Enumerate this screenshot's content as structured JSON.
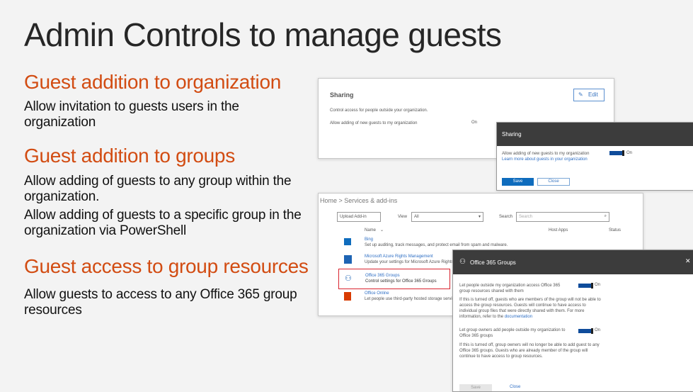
{
  "page": {
    "title": "Admin Controls to manage guests"
  },
  "sections": [
    {
      "heading": "Guest addition to organization",
      "lines": [
        "Allow invitation to guests users in the organization"
      ]
    },
    {
      "heading": "Guest addition to groups",
      "lines": [
        "Allow adding of guests to any group within the organization.",
        "Allow adding of guests to a specific group in the organization via PowerShell"
      ]
    },
    {
      "heading": "Guest access to group resources",
      "lines": [
        "Allow guests to access to any Office 365 group resources"
      ]
    }
  ],
  "sharing_panel": {
    "title": "Sharing",
    "edit_label": "Edit",
    "description": "Control access for people outside your organization.",
    "row_label": "Allow adding of new guests to my organization",
    "row_value": "On"
  },
  "sharing_dialog": {
    "title": "Sharing",
    "toggle_label": "Allow adding of new guests to my organization",
    "learn_more": "Learn more about guests in your organization",
    "toggle_state": "On",
    "save_label": "Save",
    "close_label": "Close"
  },
  "services_panel": {
    "breadcrumb": "Home > Services & add-ins",
    "upload_label": "Upload Add-in",
    "view_label": "View",
    "view_value": "All",
    "search_label": "Search",
    "search_placeholder": "Search",
    "col_name": "Name",
    "col_host": "Host Apps",
    "col_status": "Status",
    "rows": [
      {
        "name": "Bing",
        "desc": "Set up auditing, track messages, and protect email from spam and malware."
      },
      {
        "name": "Microsoft Azure Rights Management",
        "desc": "Update your settings for Microsoft Azure Rights Management"
      },
      {
        "name": "Office 365 Groups",
        "desc": "Control settings for Office 365 Groups"
      },
      {
        "name": "Office Online",
        "desc": "Let people use third-party hosted storage services"
      }
    ]
  },
  "groups_dialog": {
    "title": "Office 365 Groups",
    "close_glyph": "✕",
    "toggle1_label": "Let people outside my organization access Office 365 group resources shared with them",
    "toggle1_state": "On",
    "note1": "If this is turned off, guests who are members of the group will not be able to access the group resources. Guests will continue to have access to individual group files that were directly shared with them. For more information, refer to the",
    "note1_link": "documentation",
    "toggle2_label": "Let group owners add people outside my organization to Office 365 groups",
    "toggle2_state": "On",
    "note2": "If this is turned off, group owners will no longer be able to add guest to any Office 365 groups. Guests who are already member of the group will continue to have access to group resources.",
    "save_label": "Save",
    "close_label": "Close"
  },
  "colors": {
    "heading_orange": "#d24c12",
    "accent_blue": "#0f6cbd",
    "dialog_dark": "#3c3c3c",
    "selected_red": "#d9232e"
  },
  "icons": [
    "edit-pencil-icon",
    "chevron-down-icon",
    "search-icon",
    "close-icon",
    "groups-icon",
    "office-icon",
    "exchange-icon",
    "azure-rms-icon"
  ]
}
